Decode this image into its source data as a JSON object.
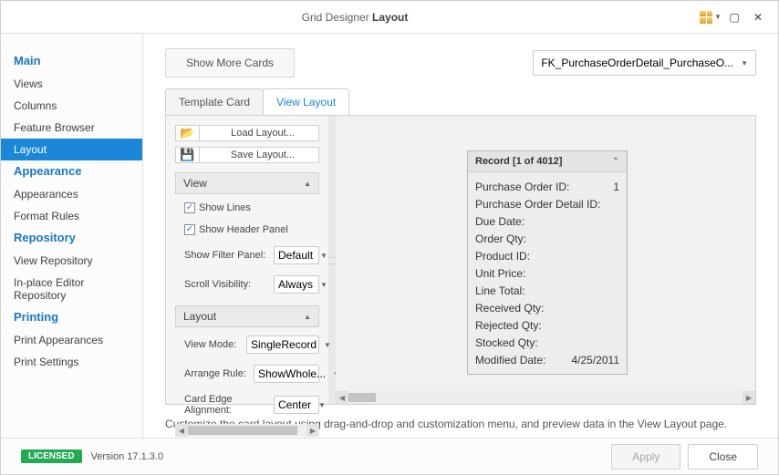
{
  "window": {
    "title_prefix": "Grid Designer",
    "title_bold": "Layout"
  },
  "sidebar": {
    "groups": [
      {
        "title": "Main",
        "items": [
          {
            "label": "Views",
            "active": false
          },
          {
            "label": "Columns",
            "active": false
          },
          {
            "label": "Feature Browser",
            "active": false
          },
          {
            "label": "Layout",
            "active": true
          }
        ]
      },
      {
        "title": "Appearance",
        "items": [
          {
            "label": "Appearances",
            "active": false
          },
          {
            "label": "Format Rules",
            "active": false
          }
        ]
      },
      {
        "title": "Repository",
        "items": [
          {
            "label": "View Repository",
            "active": false
          },
          {
            "label": "In-place Editor Repository",
            "active": false
          }
        ]
      },
      {
        "title": "Printing",
        "items": [
          {
            "label": "Print Appearances",
            "active": false
          },
          {
            "label": "Print Settings",
            "active": false
          }
        ]
      }
    ]
  },
  "toolbar": {
    "show_more": "Show More Cards",
    "combo_value": "FK_PurchaseOrderDetail_PurchaseO..."
  },
  "tabs": {
    "template": "Template Card",
    "view": "View Layout"
  },
  "left_panel": {
    "load": "Load Layout...",
    "save": "Save Layout...",
    "sections": {
      "view": {
        "title": "View",
        "show_lines": "Show Lines",
        "show_header": "Show Header Panel",
        "show_filter_label": "Show Filter Panel:",
        "show_filter_value": "Default",
        "scroll_vis_label": "Scroll Visibility:",
        "scroll_vis_value": "Always"
      },
      "layout": {
        "title": "Layout",
        "view_mode_label": "View Mode:",
        "view_mode_value": "SingleRecord",
        "arrange_label": "Arrange Rule:",
        "arrange_value": "ShowWhole...",
        "card_edge_label": "Card Edge Alignment:",
        "card_edge_value": "Center"
      }
    }
  },
  "card": {
    "title": "Record [1 of 4012]",
    "rows": [
      {
        "label": "Purchase Order ID:",
        "value": "1"
      },
      {
        "label": "Purchase Order Detail ID:",
        "value": ""
      },
      {
        "label": "Due Date:",
        "value": ""
      },
      {
        "label": "Order Qty:",
        "value": ""
      },
      {
        "label": "Product ID:",
        "value": ""
      },
      {
        "label": "Unit Price:",
        "value": ""
      },
      {
        "label": "Line Total:",
        "value": ""
      },
      {
        "label": "Received Qty:",
        "value": ""
      },
      {
        "label": "Rejected Qty:",
        "value": ""
      },
      {
        "label": "Stocked Qty:",
        "value": ""
      },
      {
        "label": "Modified Date:",
        "value": "4/25/2011"
      }
    ]
  },
  "hint": "Customize the card layout using drag-and-drop and customization menu, and preview data in the View Layout page.",
  "footer": {
    "badge": "LICENSED",
    "version": "Version 17.1.3.0",
    "apply": "Apply",
    "close": "Close"
  }
}
